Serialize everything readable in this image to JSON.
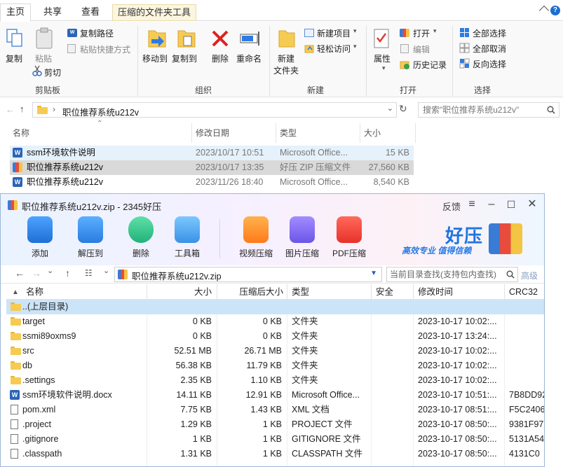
{
  "explorer": {
    "tabs": [
      "主页",
      "共享",
      "查看",
      "压缩的文件夹工具"
    ],
    "ribbon": {
      "clipboard": {
        "copy": "复制",
        "paste": "粘贴",
        "copy_path": "复制路径",
        "paste_shortcut": "粘贴快捷方式",
        "cut": "剪切",
        "label": "剪贴板"
      },
      "organize": {
        "move_to": "移动到",
        "copy_to": "复制到",
        "delete": "删除",
        "rename": "重命名",
        "label": "组织"
      },
      "new": {
        "new_folder_1": "新建",
        "new_folder_2": "文件夹",
        "new_item": "新建项目",
        "easy_access": "轻松访问",
        "label": "新建"
      },
      "open": {
        "properties": "属性",
        "open": "打开",
        "edit": "编辑",
        "history": "历史记录",
        "label": "打开"
      },
      "select": {
        "select_all": "全部选择",
        "select_none": "全部取消",
        "invert": "反向选择",
        "label": "选择"
      }
    },
    "address": {
      "path": "职位推荐系统u212v",
      "search_placeholder": "搜索\"职位推荐系统u212v\""
    },
    "columns": {
      "name": "名称",
      "date": "修改日期",
      "type": "类型",
      "size": "大小"
    },
    "files": [
      {
        "name": "ssm环境软件说明",
        "date": "2023/10/17 10:51",
        "type": "Microsoft Office...",
        "size": "15 KB",
        "icon": "word-icon"
      },
      {
        "name": "职位推荐系统u212v",
        "date": "2023/10/17 13:35",
        "type": "好压 ZIP 压缩文件",
        "size": "27,560 KB",
        "icon": "zip-icon"
      },
      {
        "name": "职位推荐系统u212v",
        "date": "2023/11/26 18:40",
        "type": "Microsoft Office...",
        "size": "8,540 KB",
        "icon": "word-icon"
      }
    ]
  },
  "haozip": {
    "title": "职位推荐系统u212v.zip - 2345好压",
    "feedback": "反馈",
    "toolbar": [
      "添加",
      "解压到",
      "删除",
      "工具箱",
      "视频压缩",
      "图片压缩",
      "PDF压缩"
    ],
    "brand": {
      "name": "好压",
      "slogan": "高效专业  值得信赖"
    },
    "path": "职位推荐系统u212v.zip",
    "search_placeholder": "当前目录查找(支持包内查找)",
    "advanced": "高级",
    "columns": [
      "名称",
      "大小",
      "压缩后大小",
      "类型",
      "安全",
      "修改时间",
      "CRC32"
    ],
    "rows": [
      {
        "name": "..(上层目录)",
        "size": "",
        "packed": "",
        "type": "",
        "time": "",
        "crc": "",
        "icon": "folder-icon"
      },
      {
        "name": "target",
        "size": "0 KB",
        "packed": "0 KB",
        "type": "文件夹",
        "time": "2023-10-17 10:02:...",
        "crc": "",
        "icon": "folder-icon"
      },
      {
        "name": "ssmi89oxms9",
        "size": "0 KB",
        "packed": "0 KB",
        "type": "文件夹",
        "time": "2023-10-17 13:24:...",
        "crc": "",
        "icon": "folder-icon"
      },
      {
        "name": "src",
        "size": "52.51 MB",
        "packed": "26.71 MB",
        "type": "文件夹",
        "time": "2023-10-17 10:02:...",
        "crc": "",
        "icon": "folder-icon"
      },
      {
        "name": "db",
        "size": "56.38 KB",
        "packed": "11.79 KB",
        "type": "文件夹",
        "time": "2023-10-17 10:02:...",
        "crc": "",
        "icon": "folder-icon"
      },
      {
        "name": ".settings",
        "size": "2.35 KB",
        "packed": "1.10 KB",
        "type": "文件夹",
        "time": "2023-10-17 10:02:...",
        "crc": "",
        "icon": "folder-icon"
      },
      {
        "name": "ssm环境软件说明.docx",
        "size": "14.11 KB",
        "packed": "12.91 KB",
        "type": "Microsoft Office...",
        "time": "2023-10-17 10:51:...",
        "crc": "7B8DD92",
        "icon": "word-icon"
      },
      {
        "name": "pom.xml",
        "size": "7.75 KB",
        "packed": "1.43 KB",
        "type": "XML 文档",
        "time": "2023-10-17 08:51:...",
        "crc": "F5C2406",
        "icon": "file-icon"
      },
      {
        "name": ".project",
        "size": "1.29 KB",
        "packed": "1 KB",
        "type": "PROJECT 文件",
        "time": "2023-10-17 08:50:...",
        "crc": "9381F97",
        "icon": "file-icon"
      },
      {
        "name": ".gitignore",
        "size": "1 KB",
        "packed": "1 KB",
        "type": "GITIGNORE 文件",
        "time": "2023-10-17 08:50:...",
        "crc": "5131A54",
        "icon": "file-icon"
      },
      {
        "name": ".classpath",
        "size": "1.31 KB",
        "packed": "1 KB",
        "type": "CLASSPATH 文件",
        "time": "2023-10-17 08:50:...",
        "crc": "4131C0",
        "icon": "file-icon"
      }
    ]
  },
  "colors": {
    "accent": "#1c6fd1",
    "selection": "#cce4f7",
    "folder": "#f6cb52"
  }
}
